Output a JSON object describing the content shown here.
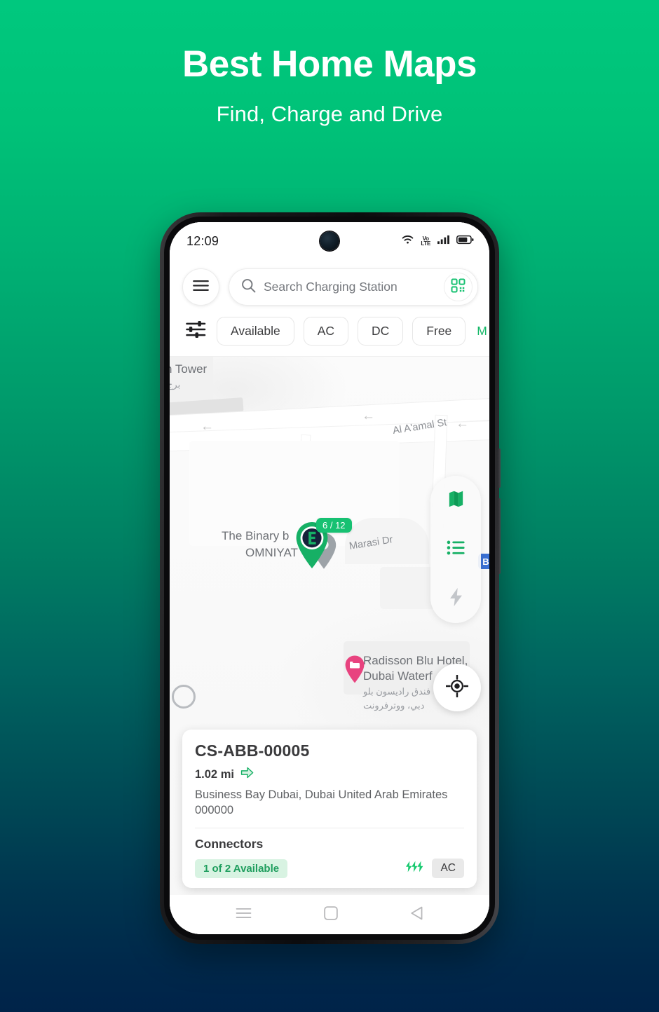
{
  "hero": {
    "title": "Best Home Maps",
    "subtitle": "Find, Charge and Drive"
  },
  "colors": {
    "brand_green": "#17c172",
    "accent_green": "#15b868",
    "gradient_top": "#00c87e",
    "gradient_bottom": "#002349",
    "available_badge_bg": "#d8f3e2",
    "available_badge_text": "#1f9e5e",
    "hotel_pin": "#e8437f",
    "edge_label_blue": "#3b71d4"
  },
  "status_bar": {
    "time": "12:09",
    "icons": [
      "wifi-icon",
      "volte-icon",
      "signal-icon",
      "battery-icon"
    ],
    "volte_top": "Vo",
    "volte_bottom": "LTE"
  },
  "header": {
    "menu_icon": "hamburger-menu-icon",
    "search": {
      "icon": "search-icon",
      "value": "",
      "placeholder": "Search Charging Station"
    },
    "qr_icon": "qr-scan-icon"
  },
  "filters": {
    "icon": "filter-sliders-icon",
    "chips": [
      {
        "label": "Available"
      },
      {
        "label": "AC"
      },
      {
        "label": "DC"
      },
      {
        "label": "Free"
      }
    ],
    "partial_chip": "M"
  },
  "map": {
    "labels": [
      {
        "text": "n Tower"
      },
      {
        "text": "برج"
      },
      {
        "text": "Al A'amal St"
      },
      {
        "text": "The Binary b"
      },
      {
        "text": "OMNIYAT"
      },
      {
        "text": "Marasi Dr"
      },
      {
        "text": "Radisson Blu Hotel,"
      },
      {
        "text": "Dubai Waterf"
      },
      {
        "text": "فندق راديسون بلو"
      },
      {
        "text": "دبي، ووترفرونت"
      }
    ],
    "station_marker": {
      "badge": "6 / 12",
      "icon": "charging-station-pin-icon"
    },
    "hotel_marker": {
      "icon": "hotel-bed-pin-icon"
    },
    "edge_label": "B",
    "controls": [
      {
        "name": "map-layer-button",
        "icon": "map-icon",
        "active": true
      },
      {
        "name": "list-view-button",
        "icon": "list-icon",
        "active": true
      },
      {
        "name": "charging-filter-button",
        "icon": "bolt-icon",
        "active": false
      }
    ],
    "locate_button": {
      "icon": "locate-crosshair-icon"
    }
  },
  "station_card": {
    "title": "CS-ABB-00005",
    "distance": "1.02 mi",
    "direction_icon": "directions-arrow-icon",
    "address": "Business Bay Dubai, Dubai United Arab Emirates 000000",
    "connectors_label": "Connectors",
    "availability": "1 of 2 Available",
    "bolts_icon": "triple-bolt-icon",
    "current_type": "AC"
  },
  "nav_bar": {
    "items": [
      {
        "name": "recents-button",
        "icon": "hamburger-icon"
      },
      {
        "name": "home-button",
        "icon": "square-icon"
      },
      {
        "name": "back-button",
        "icon": "triangle-back-icon"
      }
    ]
  }
}
